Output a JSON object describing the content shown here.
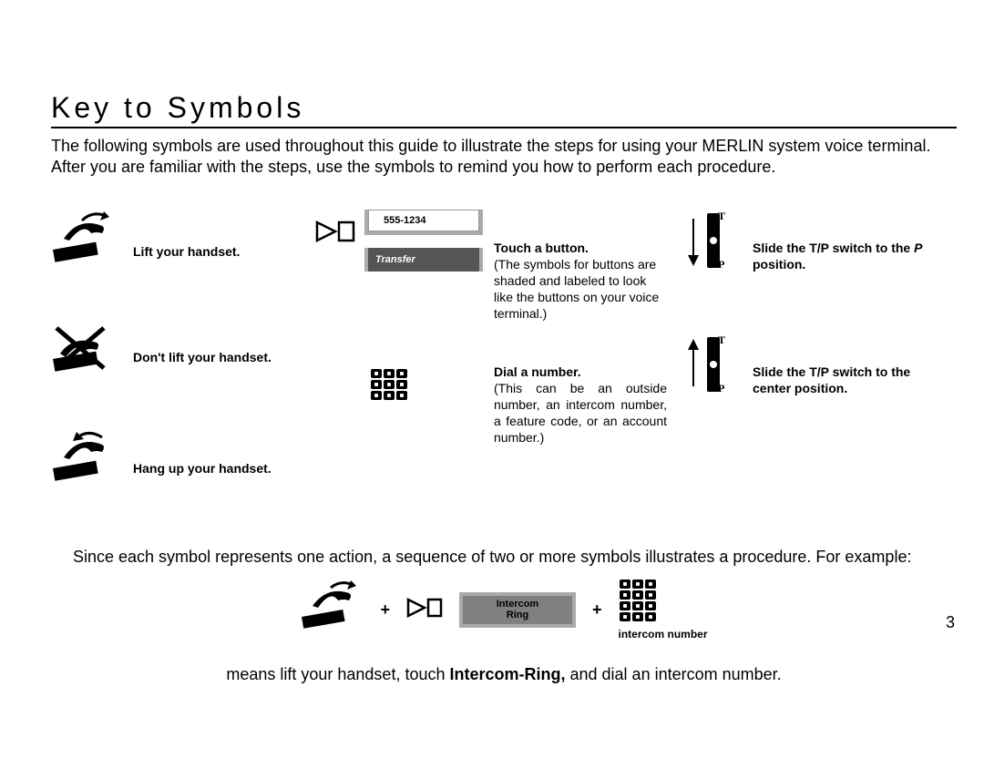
{
  "title": "Key to Symbols",
  "intro": "The following symbols are used throughout this guide to illustrate the steps for using your MERLIN system voice terminal. After you are familiar with the steps, use the symbols to remind you how to perform each procedure.",
  "col1": {
    "lift": "Lift your handset.",
    "dont": "Don't lift your handset.",
    "hang": "Hang up your handset."
  },
  "col2": {
    "btn_white": "555-1234",
    "btn_dark": "Transfer",
    "touch_bold": "Touch a button.",
    "touch_plain": "(The symbols for buttons are shaded and labeled to look like the buttons on your voice terminal.)",
    "dial_bold": "Dial a number.",
    "dial_plain": "(This can be an outside number, an intercom number, a feature code, or an account number.)"
  },
  "col3": {
    "t": "T",
    "p": "P",
    "slide_p_bold": "Slide the T/P switch to the ",
    "slide_p_italic": "P",
    "slide_p_bold2": " position.",
    "slide_c": "Slide the T/P switch to the center position."
  },
  "example_intro": "Since each symbol represents one action, a sequence of two or more symbols illustrates a procedure. For example:",
  "example": {
    "plus": "+",
    "intercom1": "Intercom",
    "intercom2": "Ring",
    "kp_caption": "intercom number"
  },
  "means_pre": "means lift your handset, touch ",
  "means_bold": "Intercom-Ring,",
  "means_post": " and dial an intercom number.",
  "page_num": "3"
}
